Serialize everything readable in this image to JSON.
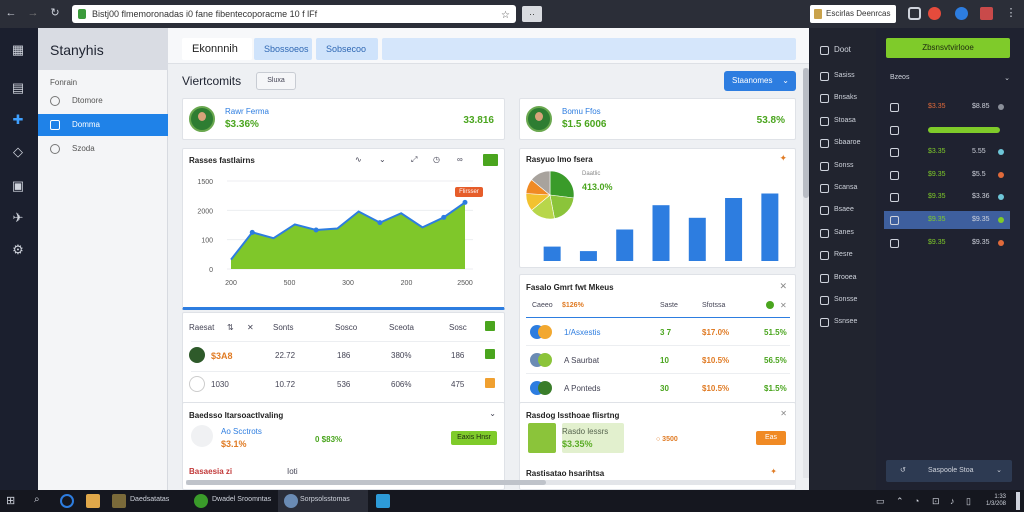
{
  "browser": {
    "url": "Bistj00 flmemoronadas i0 fane fibentecoporacme 10 f lFf",
    "profile": "Escirlas Deenrcas",
    "ext_label": "··"
  },
  "sidebar": {
    "brand": "Stanyhis",
    "section": "Fonrain",
    "items": [
      {
        "label": "Dtomore"
      },
      {
        "label": "Domma"
      },
      {
        "label": "Szoda"
      }
    ]
  },
  "tabs": [
    {
      "label": "Ekonnnih"
    },
    {
      "label": "Sbossoeos"
    },
    {
      "label": "Sobsecoo"
    },
    {
      "label": ""
    }
  ],
  "page": {
    "title": "Viertcomits",
    "small_button": "Sluxa",
    "dropdown": "Staanomes"
  },
  "kpi": [
    {
      "name": "Rawr Ferma",
      "value": "$3.36%",
      "right": "33.816"
    },
    {
      "name": "Bomu Ffos",
      "value": "$1.5 6006",
      "right": "53.8%"
    }
  ],
  "line_card": {
    "title": "Rasses fastlairns",
    "badge": "Flirsser",
    "y_ticks": [
      "1500",
      "2000",
      "100",
      "0"
    ],
    "x_ticks": [
      "200",
      "500",
      "300",
      "200",
      "2500"
    ]
  },
  "chart_data": [
    {
      "type": "area",
      "title": "Rasses fastlairns",
      "x": [
        "200",
        "",
        "",
        "500",
        "",
        "",
        "300",
        "",
        "",
        "200",
        "",
        "2500"
      ],
      "values": [
        320,
        1250,
        1050,
        1520,
        1330,
        1380,
        1960,
        1580,
        1900,
        1420,
        1760,
        2270
      ],
      "ylim": [
        0,
        3000
      ],
      "ytick_labels": [
        "1500",
        "2000",
        "100",
        "0"
      ],
      "xtick_labels": [
        "200",
        "500",
        "300",
        "200",
        "2500"
      ],
      "grid": true,
      "color": "#7fc72a",
      "line_color": "#2d7de0"
    },
    {
      "type": "pie",
      "title": "Rasyuo lmo fsera",
      "slices": [
        {
          "value": 27,
          "color": "#3a9b2a"
        },
        {
          "value": 20,
          "color": "#8bc43a"
        },
        {
          "value": 17,
          "color": "#b8d64a"
        },
        {
          "value": 12,
          "color": "#f2c230"
        },
        {
          "value": 10,
          "color": "#f08a24"
        },
        {
          "value": 14,
          "color": "#a8a39d"
        }
      ]
    },
    {
      "type": "bar",
      "title": "Rasyuo lmo fsera",
      "categories": [
        "",
        "",
        "",
        "",
        "",
        "",
        ""
      ],
      "values": [
        16,
        11,
        35,
        62,
        48,
        70,
        75
      ],
      "ylim": [
        0,
        80
      ],
      "color": "#2d7de0"
    }
  ],
  "pie_card": {
    "title": "Rasyuo lmo fsera",
    "subtitle": "Daatlic",
    "value": "413.0%"
  },
  "table_left": {
    "headers": [
      "Raesat",
      "Sonts",
      "Sosco",
      "Sceota",
      "Sosc"
    ],
    "rows": [
      [
        "$3A8",
        "22.72",
        "186",
        "380%",
        "186"
      ],
      [
        "1030",
        "10.72",
        "536",
        "606%",
        "475"
      ]
    ]
  },
  "table_right": {
    "title": "Fasalo Gmrt fwt Mkeus",
    "headers": [
      "Caeeo",
      "$126%",
      "Saste",
      "Sfotssa"
    ],
    "rows": [
      [
        "1/Asxestis",
        "3 7",
        "$17.0%",
        "51.5%"
      ],
      [
        "A Saurbat",
        "10",
        "$10.5%",
        "56.5%"
      ],
      [
        "A Ponteds",
        "30",
        "$10.5%",
        "$1.5%"
      ]
    ]
  },
  "bottom_left": {
    "title": "Baedsso ltarsoactlvaling",
    "name": "Ao Scctrots",
    "value": "$3.1%",
    "sub": "0 $83%",
    "button": "Eaxis Hnsr",
    "footer_a": "Basaesia zi",
    "footer_b": "Ioti"
  },
  "bottom_right": {
    "title": "Rasdog lssthoae flisrtng",
    "name": "Rasdo lessrs",
    "value": "$3.35%",
    "sub": "○ 3500",
    "button": "Eas",
    "footer": "Rastisatao hsarihtsa"
  },
  "right_nav": {
    "header": "Doot",
    "items": [
      "Sasiss",
      "Bnsaks",
      "Stoasa",
      "Sbaaroe",
      "Sonss",
      "Scansa",
      "Bsaee",
      "Sanes",
      "Resre",
      "Brooea",
      "Sonsse",
      "Ssnsee"
    ]
  },
  "right_panel": {
    "button": "Zbsnsvtvirlooe",
    "section": "Bzeos",
    "rows": [
      {
        "a": "$3.35",
        "b": "$8.85",
        "dot": "#8a8f99"
      },
      {
        "a": "",
        "b": "",
        "dot": "#7fcb2a"
      },
      {
        "a": "$3.35",
        "b": "5.55",
        "dot": "#6ec6d8"
      },
      {
        "a": "$9.35",
        "b": "$5.5",
        "dot": "#e06a3a"
      },
      {
        "a": "$9.35",
        "b": "$3.36",
        "dot": "#6ec6d8"
      },
      {
        "a": "$9.35",
        "b": "$9.35",
        "dot": "#7fcb2a"
      },
      {
        "a": "$9.35",
        "b": "$9.35",
        "dot": "#e06a3a"
      }
    ],
    "footer": "Saspoole Stoa"
  },
  "taskbar": {
    "apps": [
      "Daedsatatas",
      "Dwadel Sroomntas",
      "Sorpsolsstomas"
    ],
    "clock_time": "1:33",
    "clock_date": "1/3/208"
  }
}
